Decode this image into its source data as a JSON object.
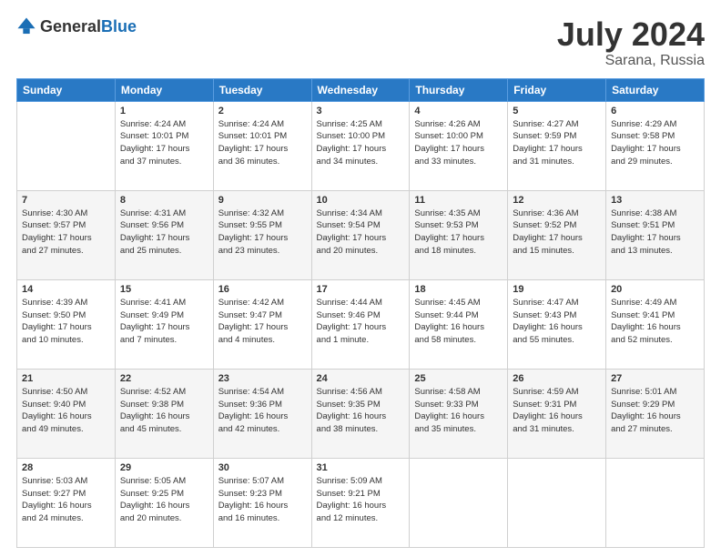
{
  "header": {
    "logo_general": "General",
    "logo_blue": "Blue",
    "title": "July 2024",
    "subtitle": "Sarana, Russia"
  },
  "weekdays": [
    "Sunday",
    "Monday",
    "Tuesday",
    "Wednesday",
    "Thursday",
    "Friday",
    "Saturday"
  ],
  "weeks": [
    [
      {
        "day": "",
        "info": ""
      },
      {
        "day": "1",
        "info": "Sunrise: 4:24 AM\nSunset: 10:01 PM\nDaylight: 17 hours\nand 37 minutes."
      },
      {
        "day": "2",
        "info": "Sunrise: 4:24 AM\nSunset: 10:01 PM\nDaylight: 17 hours\nand 36 minutes."
      },
      {
        "day": "3",
        "info": "Sunrise: 4:25 AM\nSunset: 10:00 PM\nDaylight: 17 hours\nand 34 minutes."
      },
      {
        "day": "4",
        "info": "Sunrise: 4:26 AM\nSunset: 10:00 PM\nDaylight: 17 hours\nand 33 minutes."
      },
      {
        "day": "5",
        "info": "Sunrise: 4:27 AM\nSunset: 9:59 PM\nDaylight: 17 hours\nand 31 minutes."
      },
      {
        "day": "6",
        "info": "Sunrise: 4:29 AM\nSunset: 9:58 PM\nDaylight: 17 hours\nand 29 minutes."
      }
    ],
    [
      {
        "day": "7",
        "info": "Sunrise: 4:30 AM\nSunset: 9:57 PM\nDaylight: 17 hours\nand 27 minutes."
      },
      {
        "day": "8",
        "info": "Sunrise: 4:31 AM\nSunset: 9:56 PM\nDaylight: 17 hours\nand 25 minutes."
      },
      {
        "day": "9",
        "info": "Sunrise: 4:32 AM\nSunset: 9:55 PM\nDaylight: 17 hours\nand 23 minutes."
      },
      {
        "day": "10",
        "info": "Sunrise: 4:34 AM\nSunset: 9:54 PM\nDaylight: 17 hours\nand 20 minutes."
      },
      {
        "day": "11",
        "info": "Sunrise: 4:35 AM\nSunset: 9:53 PM\nDaylight: 17 hours\nand 18 minutes."
      },
      {
        "day": "12",
        "info": "Sunrise: 4:36 AM\nSunset: 9:52 PM\nDaylight: 17 hours\nand 15 minutes."
      },
      {
        "day": "13",
        "info": "Sunrise: 4:38 AM\nSunset: 9:51 PM\nDaylight: 17 hours\nand 13 minutes."
      }
    ],
    [
      {
        "day": "14",
        "info": "Sunrise: 4:39 AM\nSunset: 9:50 PM\nDaylight: 17 hours\nand 10 minutes."
      },
      {
        "day": "15",
        "info": "Sunrise: 4:41 AM\nSunset: 9:49 PM\nDaylight: 17 hours\nand 7 minutes."
      },
      {
        "day": "16",
        "info": "Sunrise: 4:42 AM\nSunset: 9:47 PM\nDaylight: 17 hours\nand 4 minutes."
      },
      {
        "day": "17",
        "info": "Sunrise: 4:44 AM\nSunset: 9:46 PM\nDaylight: 17 hours\nand 1 minute."
      },
      {
        "day": "18",
        "info": "Sunrise: 4:45 AM\nSunset: 9:44 PM\nDaylight: 16 hours\nand 58 minutes."
      },
      {
        "day": "19",
        "info": "Sunrise: 4:47 AM\nSunset: 9:43 PM\nDaylight: 16 hours\nand 55 minutes."
      },
      {
        "day": "20",
        "info": "Sunrise: 4:49 AM\nSunset: 9:41 PM\nDaylight: 16 hours\nand 52 minutes."
      }
    ],
    [
      {
        "day": "21",
        "info": "Sunrise: 4:50 AM\nSunset: 9:40 PM\nDaylight: 16 hours\nand 49 minutes."
      },
      {
        "day": "22",
        "info": "Sunrise: 4:52 AM\nSunset: 9:38 PM\nDaylight: 16 hours\nand 45 minutes."
      },
      {
        "day": "23",
        "info": "Sunrise: 4:54 AM\nSunset: 9:36 PM\nDaylight: 16 hours\nand 42 minutes."
      },
      {
        "day": "24",
        "info": "Sunrise: 4:56 AM\nSunset: 9:35 PM\nDaylight: 16 hours\nand 38 minutes."
      },
      {
        "day": "25",
        "info": "Sunrise: 4:58 AM\nSunset: 9:33 PM\nDaylight: 16 hours\nand 35 minutes."
      },
      {
        "day": "26",
        "info": "Sunrise: 4:59 AM\nSunset: 9:31 PM\nDaylight: 16 hours\nand 31 minutes."
      },
      {
        "day": "27",
        "info": "Sunrise: 5:01 AM\nSunset: 9:29 PM\nDaylight: 16 hours\nand 27 minutes."
      }
    ],
    [
      {
        "day": "28",
        "info": "Sunrise: 5:03 AM\nSunset: 9:27 PM\nDaylight: 16 hours\nand 24 minutes."
      },
      {
        "day": "29",
        "info": "Sunrise: 5:05 AM\nSunset: 9:25 PM\nDaylight: 16 hours\nand 20 minutes."
      },
      {
        "day": "30",
        "info": "Sunrise: 5:07 AM\nSunset: 9:23 PM\nDaylight: 16 hours\nand 16 minutes."
      },
      {
        "day": "31",
        "info": "Sunrise: 5:09 AM\nSunset: 9:21 PM\nDaylight: 16 hours\nand 12 minutes."
      },
      {
        "day": "",
        "info": ""
      },
      {
        "day": "",
        "info": ""
      },
      {
        "day": "",
        "info": ""
      }
    ]
  ]
}
